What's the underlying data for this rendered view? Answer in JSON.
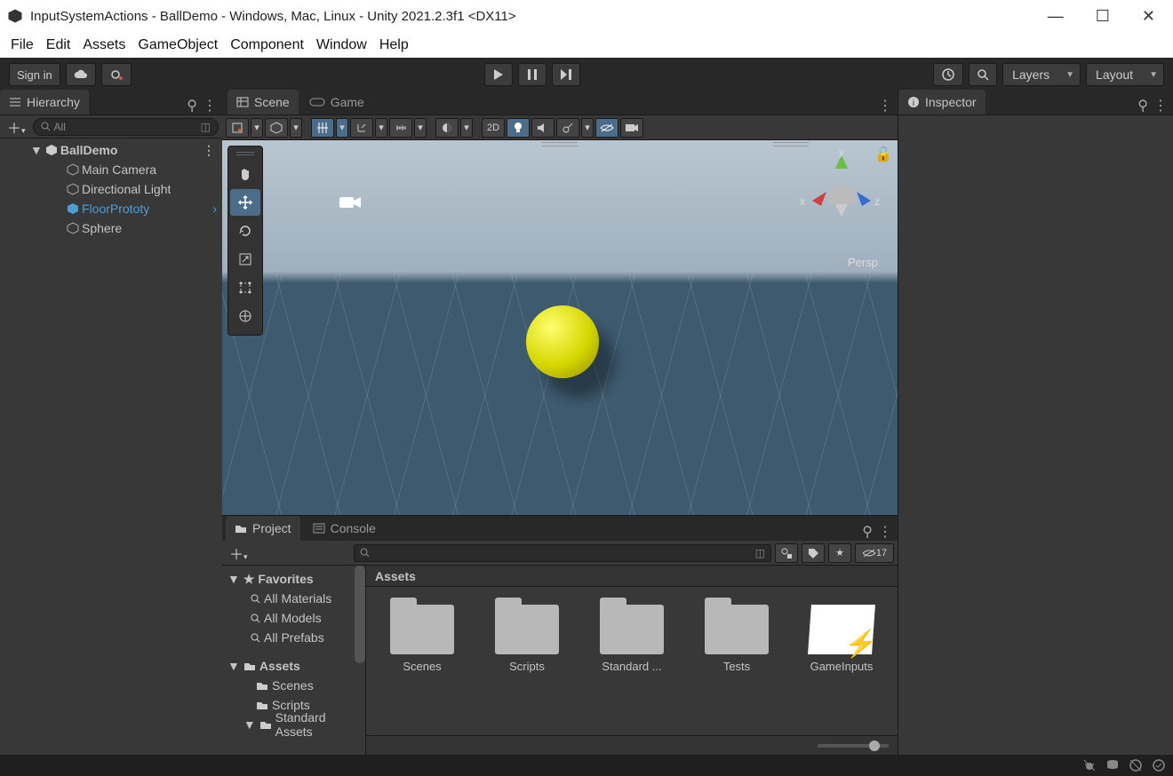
{
  "window": {
    "title": "InputSystemActions - BallDemo - Windows, Mac, Linux - Unity 2021.2.3f1 <DX11>"
  },
  "menu": [
    "File",
    "Edit",
    "Assets",
    "GameObject",
    "Component",
    "Window",
    "Help"
  ],
  "toolbar": {
    "signin": "Sign in",
    "layers": "Layers",
    "layout": "Layout"
  },
  "hierarchy": {
    "tab": "Hierarchy",
    "search_placeholder": "All",
    "scene": "BallDemo",
    "items": [
      {
        "name": "Main Camera",
        "selected": false
      },
      {
        "name": "Directional Light",
        "selected": false
      },
      {
        "name": "FloorPrototy",
        "selected": true
      },
      {
        "name": "Sphere",
        "selected": false
      }
    ]
  },
  "scene": {
    "tab_scene": "Scene",
    "tab_game": "Game",
    "mode_2d": "2D",
    "projection": "Persp",
    "axes": {
      "x": "x",
      "y": "y",
      "z": "z"
    }
  },
  "inspector": {
    "tab": "Inspector"
  },
  "project": {
    "tab_project": "Project",
    "tab_console": "Console",
    "hidden_count": "17",
    "crumb": "Assets",
    "favorites_label": "Favorites",
    "favorites": [
      "All Materials",
      "All Models",
      "All Prefabs"
    ],
    "assets_label": "Assets",
    "tree": [
      "Scenes",
      "Scripts",
      "Standard Assets"
    ],
    "grid": [
      {
        "name": "Scenes",
        "type": "folder"
      },
      {
        "name": "Scripts",
        "type": "folder"
      },
      {
        "name": "Standard ...",
        "type": "folder"
      },
      {
        "name": "Tests",
        "type": "folder"
      },
      {
        "name": "GameInputs",
        "type": "inputactions"
      }
    ]
  }
}
